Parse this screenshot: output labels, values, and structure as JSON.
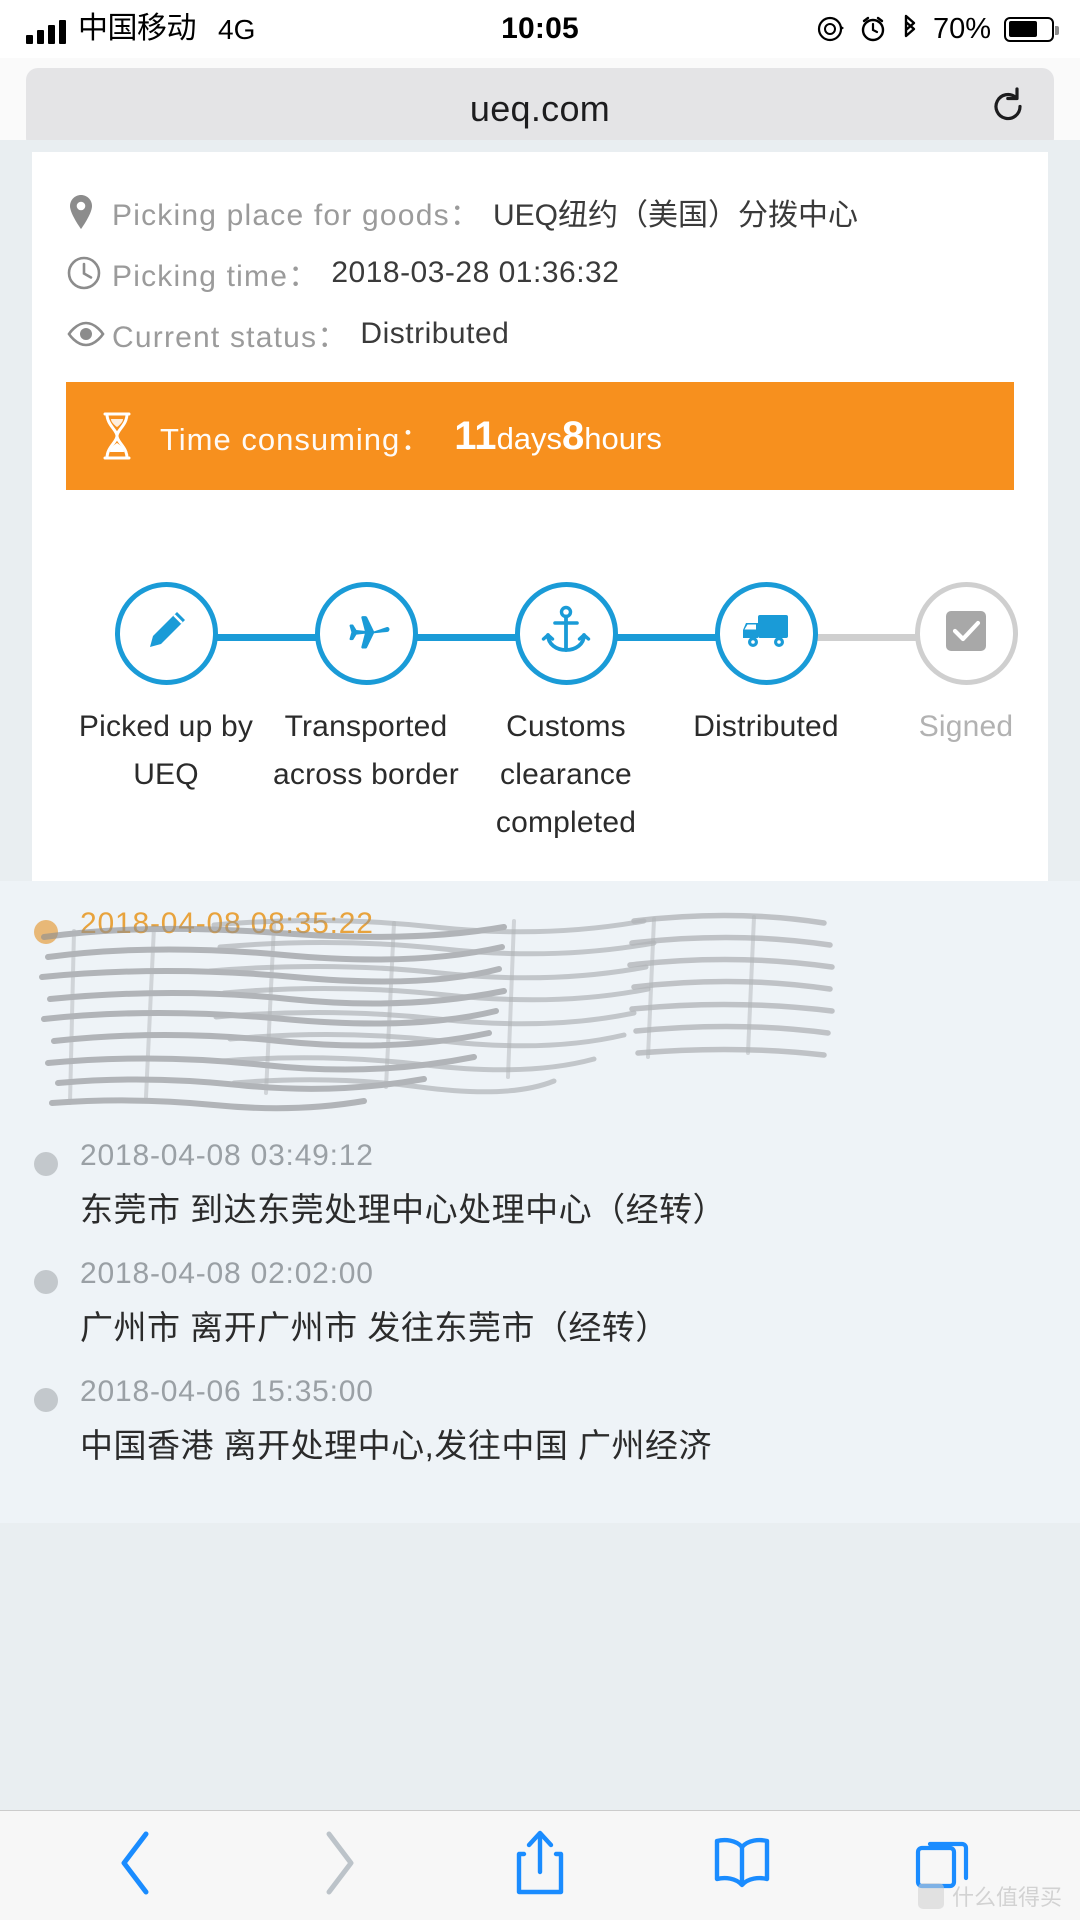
{
  "status_bar": {
    "carrier": "中国移动",
    "network": "4G",
    "time": "10:05",
    "battery_percent": "70%",
    "icons": [
      "signal-bars-icon",
      "rotation-lock-icon",
      "alarm-clock-icon",
      "bluetooth-icon",
      "battery-icon"
    ]
  },
  "browser": {
    "url": "ueq.com",
    "reload_label": "reload-icon"
  },
  "shipment": {
    "place_label": "Picking place for goods：",
    "place_value": "UEQ纽约（美国）分拨中心",
    "time_label": "Picking time：",
    "time_value": "2018-03-28 01:36:32",
    "status_label": "Current status：",
    "status_value": "Distributed"
  },
  "banner": {
    "label": "Time consuming：",
    "days_number": "11",
    "days_unit": "days",
    "hours_number": "8",
    "hours_unit": "hours",
    "bg_color": "#f7901e",
    "icon": "hourglass-icon"
  },
  "stepper": {
    "active_color": "#1a9bd7",
    "inactive_color": "#cfcfcf",
    "steps": [
      {
        "icon": "pencil-icon",
        "label": "Picked up by UEQ",
        "active": true
      },
      {
        "icon": "airplane-icon",
        "label": "Transported across border",
        "active": true
      },
      {
        "icon": "anchor-icon",
        "label": "Customs clearance completed",
        "active": true
      },
      {
        "icon": "truck-icon",
        "label": "Distributed",
        "active": true
      },
      {
        "icon": "check-square-icon",
        "label": "Signed",
        "active": false
      }
    ]
  },
  "tracking": {
    "items": [
      {
        "time": "2018-04-08 08:35:22",
        "desc": "",
        "redacted": true,
        "time_color": "#e8a33d"
      },
      {
        "time": "2018-04-08 03:49:12",
        "desc": "东莞市 到达东莞处理中心处理中心（经转）",
        "redacted": false
      },
      {
        "time": "2018-04-08 02:02:00",
        "desc": "广州市 离开广州市 发往东莞市（经转）",
        "redacted": false
      },
      {
        "time": "2018-04-06 15:35:00",
        "desc": "中国香港 离开处理中心,发往中国 广州经济",
        "redacted": false
      }
    ]
  },
  "toolbar": {
    "buttons": [
      {
        "name": "back-button",
        "icon": "chevron-left-icon",
        "enabled": true
      },
      {
        "name": "forward-button",
        "icon": "chevron-right-icon",
        "enabled": false
      },
      {
        "name": "share-button",
        "icon": "share-icon",
        "enabled": true
      },
      {
        "name": "bookmarks-button",
        "icon": "book-icon",
        "enabled": true
      },
      {
        "name": "tabs-button",
        "icon": "tabs-icon",
        "enabled": true
      }
    ]
  },
  "watermark": {
    "text": "什么值得买"
  }
}
